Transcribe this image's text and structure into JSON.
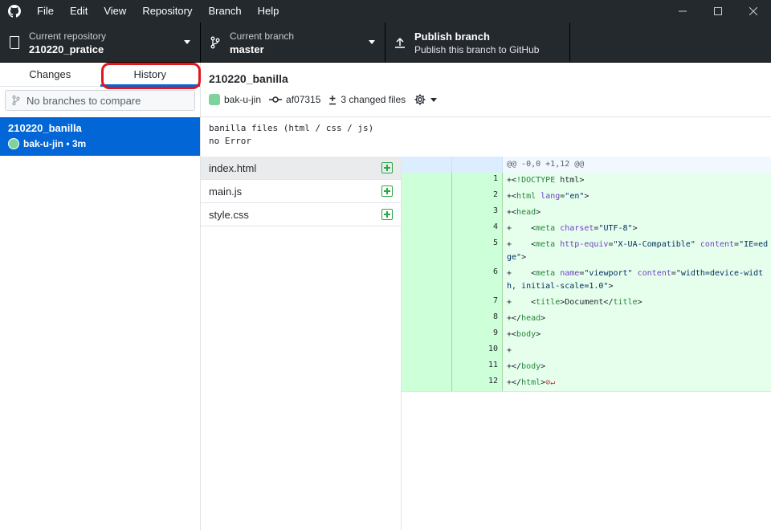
{
  "menu": [
    "File",
    "Edit",
    "View",
    "Repository",
    "Branch",
    "Help"
  ],
  "toolbar": {
    "repo_label": "Current repository",
    "repo_value": "210220_pratice",
    "branch_label": "Current branch",
    "branch_value": "master",
    "publish_label": "Publish branch",
    "publish_sub": "Publish this branch to GitHub"
  },
  "sidebar": {
    "tab_changes": "Changes",
    "tab_history": "History",
    "compare_placeholder": "No branches to compare",
    "commit_title": "210220_banilla",
    "commit_meta": "bak-u-jin • 3m"
  },
  "commit": {
    "title": "210220_banilla",
    "author": "bak-u-jin",
    "sha": "af07315",
    "changed": "3 changed files",
    "desc_line1": "banilla files (html / css / js)",
    "desc_line2": "no Error"
  },
  "files": [
    {
      "name": "index.html"
    },
    {
      "name": "main.js"
    },
    {
      "name": "style.css"
    }
  ],
  "diff": {
    "hunk": "@@ -0,0 +1,12 @@",
    "lines": [
      {
        "n": "1",
        "code": "+<!DOCTYPE html>"
      },
      {
        "n": "2",
        "code": "+<html lang=\"en\">"
      },
      {
        "n": "3",
        "code": "+<head>"
      },
      {
        "n": "4",
        "code": "+    <meta charset=\"UTF-8\">"
      },
      {
        "n": "5",
        "code": "+    <meta http-equiv=\"X-UA-Compatible\" content=\"IE=edge\">"
      },
      {
        "n": "6",
        "code": "+    <meta name=\"viewport\" content=\"width=device-width, initial-scale=1.0\">"
      },
      {
        "n": "7",
        "code": "+    <title>Document</title>"
      },
      {
        "n": "8",
        "code": "+</head>"
      },
      {
        "n": "9",
        "code": "+<body>"
      },
      {
        "n": "10",
        "code": "+"
      },
      {
        "n": "11",
        "code": "+</body>"
      },
      {
        "n": "12",
        "code": "+</html>"
      }
    ]
  }
}
